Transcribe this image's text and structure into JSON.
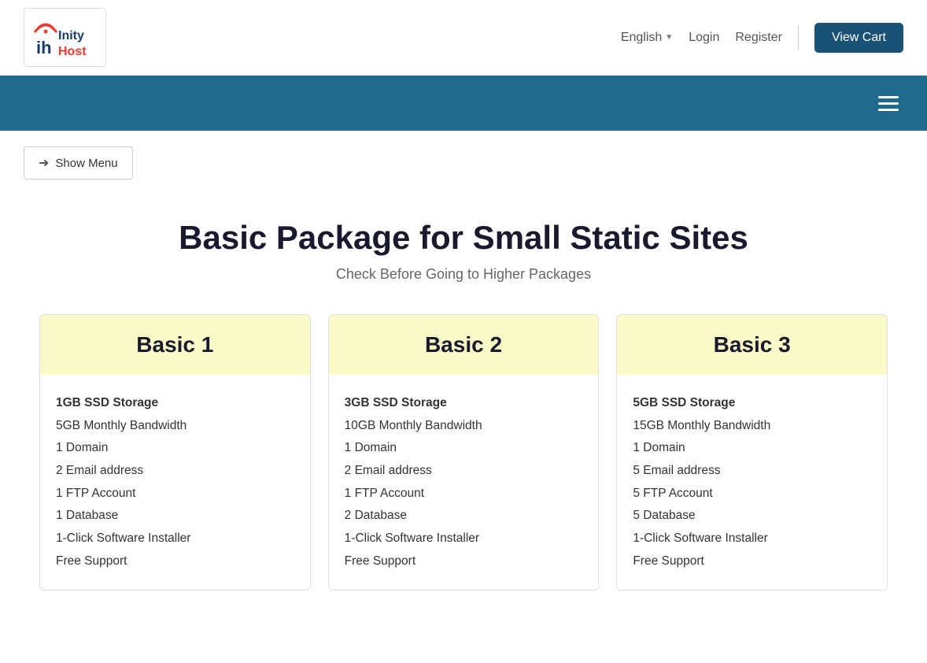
{
  "header": {
    "logo": {
      "inity": "Inity",
      "host": "Host",
      "alt": "InityHost Logo"
    },
    "lang_label": "English",
    "login_label": "Login",
    "register_label": "Register",
    "view_cart_label": "View Cart"
  },
  "navbar": {
    "menu_icon_alt": "hamburger-menu"
  },
  "show_menu": {
    "label": "Show Menu"
  },
  "page_title": {
    "title": "Basic Package for Small Static Sites",
    "subtitle": "Check Before Going to Higher Packages"
  },
  "packages": [
    {
      "name": "Basic 1",
      "features": [
        {
          "bold": "1GB SSD Storage",
          "rest": ""
        },
        {
          "bold": "",
          "rest": "5GB Monthly Bandwidth"
        },
        {
          "bold": "",
          "rest": "1 Domain"
        },
        {
          "bold": "",
          "rest": "2 Email address"
        },
        {
          "bold": "",
          "rest": "1 FTP Account"
        },
        {
          "bold": "",
          "rest": "1 Database"
        },
        {
          "bold": "",
          "rest": "1-Click Software Installer"
        },
        {
          "bold": "",
          "rest": "Free Support"
        }
      ]
    },
    {
      "name": "Basic 2",
      "features": [
        {
          "bold": "3GB SSD Storage",
          "rest": ""
        },
        {
          "bold": "",
          "rest": "10GB Monthly Bandwidth"
        },
        {
          "bold": "",
          "rest": "1 Domain"
        },
        {
          "bold": "",
          "rest": "2 Email address"
        },
        {
          "bold": "",
          "rest": "1 FTP Account"
        },
        {
          "bold": "",
          "rest": "2 Database"
        },
        {
          "bold": "",
          "rest": "1-Click Software Installer"
        },
        {
          "bold": "",
          "rest": "Free Support"
        }
      ]
    },
    {
      "name": "Basic 3",
      "features": [
        {
          "bold": "5GB SSD Storage",
          "rest": ""
        },
        {
          "bold": "",
          "rest": "15GB Monthly Bandwidth"
        },
        {
          "bold": "",
          "rest": "1 Domain"
        },
        {
          "bold": "",
          "rest": "5 Email address"
        },
        {
          "bold": "",
          "rest": "5 FTP Account"
        },
        {
          "bold": "",
          "rest": "5 Database"
        },
        {
          "bold": "",
          "rest": "1-Click Software Installer"
        },
        {
          "bold": "",
          "rest": "Free Support"
        }
      ]
    }
  ]
}
